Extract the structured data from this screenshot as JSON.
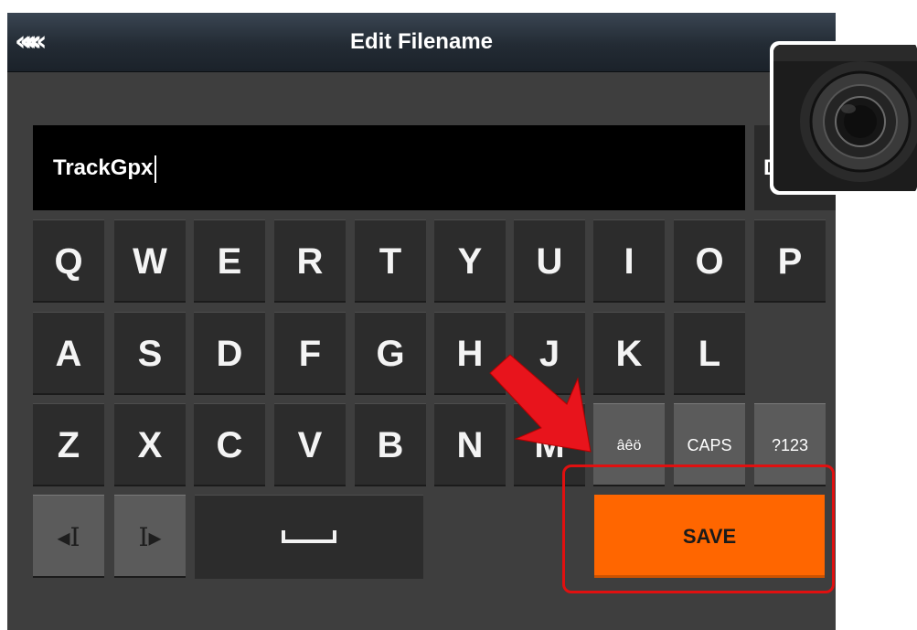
{
  "header": {
    "back_glyph": "««««",
    "title": "Edit Filename"
  },
  "filename": {
    "value": "TrackGpx"
  },
  "delete_key": {
    "visible_letter": "D"
  },
  "keyboard": {
    "row1": [
      "Q",
      "W",
      "E",
      "R",
      "T",
      "Y",
      "U",
      "I",
      "O",
      "P"
    ],
    "row2": [
      "A",
      "S",
      "D",
      "F",
      "G",
      "H",
      "J",
      "K",
      "L"
    ],
    "row3": [
      "Z",
      "X",
      "C",
      "V",
      "B",
      "N",
      "M",
      "âêö",
      "CAPS",
      "?123"
    ],
    "cursor_left_glyph": "◂I",
    "cursor_right_glyph": "I▸",
    "space_icon": "space-bar-icon",
    "save_label": "SAVE"
  },
  "colors": {
    "save_orange": "#ff6600",
    "highlight_red": "#e01010",
    "key_dark": "#2c2c2c",
    "key_gray": "#5b5b5b",
    "background": "#3e3e3e"
  },
  "annotations": {
    "arrow_icon": "red-arrow-icon",
    "highlight": "save-highlight-box",
    "inset_icon": "rotary-knob-icon"
  }
}
